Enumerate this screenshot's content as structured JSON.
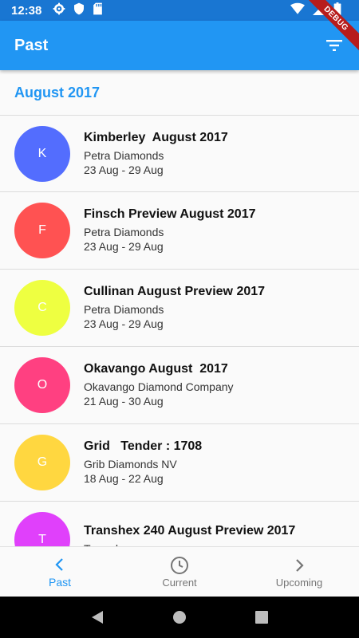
{
  "status_bar": {
    "time": "12:38",
    "icons_left": [
      "gear-icon",
      "shield-icon",
      "sdcard-icon"
    ],
    "icons_right": [
      "wifi-icon",
      "signal-icon",
      "battery-icon"
    ]
  },
  "debug_banner": "DEBUG",
  "app_bar": {
    "title": "Past",
    "action_icon": "filter-icon"
  },
  "section": {
    "header": "August 2017"
  },
  "items": [
    {
      "initial": "K",
      "title": "Kimberley  August 2017",
      "company": "Petra Diamonds",
      "dates": "23 Aug - 29 Aug",
      "color": "#536dfe"
    },
    {
      "initial": "F",
      "title": "Finsch Preview August 2017",
      "company": "Petra Diamonds",
      "dates": "23 Aug - 29 Aug",
      "color": "#ff5252"
    },
    {
      "initial": "C",
      "title": "Cullinan August Preview 2017",
      "company": "Petra Diamonds",
      "dates": "23 Aug - 29 Aug",
      "color": "#eeff41"
    },
    {
      "initial": "O",
      "title": "Okavango August  2017",
      "company": "Okavango Diamond Company",
      "dates": "21 Aug - 30 Aug",
      "color": "#ff4081"
    },
    {
      "initial": "G",
      "title": "Grid   Tender : 1708",
      "company": "Grib Diamonds NV",
      "dates": "18 Aug - 22 Aug",
      "color": "#ffd740"
    },
    {
      "initial": "T",
      "title": "Transhex 240 August Preview 2017",
      "company": "Trans-hex",
      "dates": "",
      "color": "#e040fb"
    }
  ],
  "bottom_nav": [
    {
      "label": "Past",
      "icon": "chevron-left-icon",
      "active": true
    },
    {
      "label": "Current",
      "icon": "clock-icon",
      "active": false
    },
    {
      "label": "Upcoming",
      "icon": "chevron-right-icon",
      "active": false
    }
  ],
  "colors": {
    "app_bar": "#2196f3",
    "status_bar": "#1976d2",
    "accent": "#2196f3"
  }
}
